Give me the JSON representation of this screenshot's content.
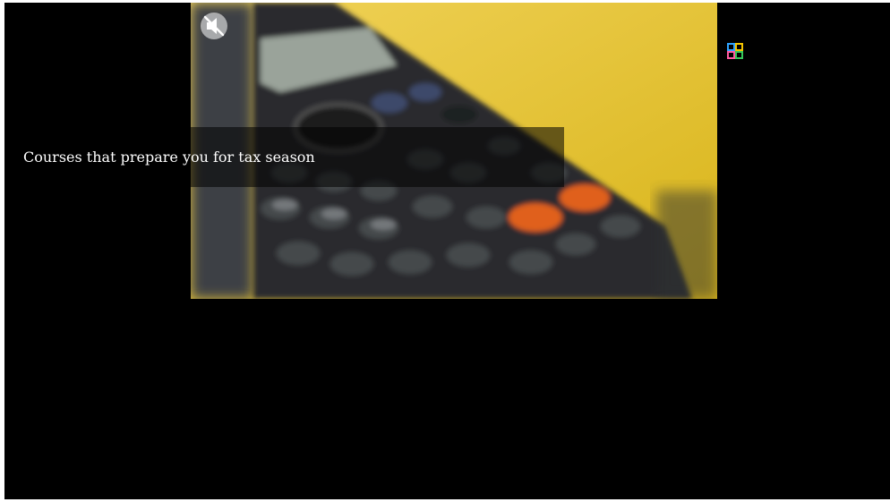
{
  "video": {
    "caption": "Courses that prepare you for tax season",
    "muted": true,
    "thumbnail_subject": "calculator on yellow background"
  },
  "icons": {
    "mute": "speaker-muted-icon",
    "logo": "brand-logo-icon"
  },
  "colors": {
    "background": "#000000",
    "thumbnail_backdrop": "#e8c93c",
    "caption_text": "#ffffff"
  }
}
